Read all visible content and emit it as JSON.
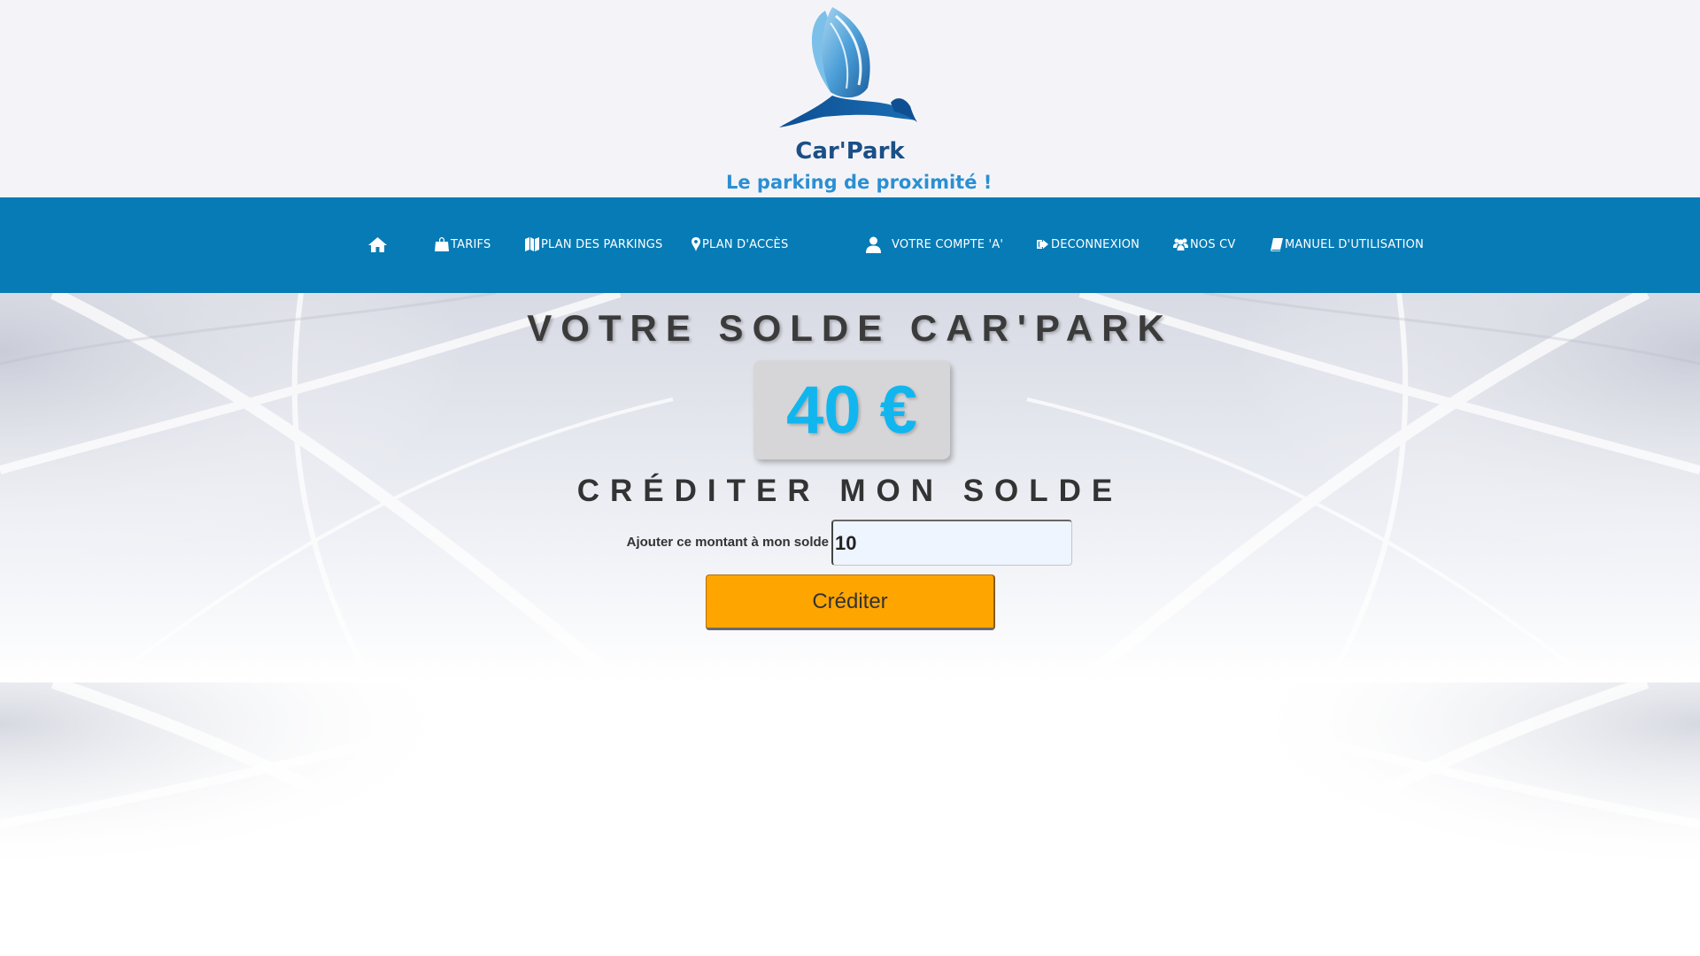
{
  "brand": {
    "name": "Car'Park",
    "tagline": "Le parking de proximité !"
  },
  "nav": {
    "items": [
      {
        "label": "",
        "icon": "home-icon"
      },
      {
        "label": "TARIFS",
        "icon": "shopping-bag-icon"
      },
      {
        "label": "PLAN DES PARKINGS",
        "icon": "map-icon"
      },
      {
        "label": "PLAN D'ACCÈS",
        "icon": "map-marker-icon"
      },
      {
        "label": "VOTRE COMPTE 'A'",
        "icon": "user-icon"
      },
      {
        "label": "DECONNEXION",
        "icon": "sign-out-icon"
      },
      {
        "label": "NOS CV",
        "icon": "users-icon"
      },
      {
        "label": "MANUEL D'UTILISATION",
        "icon": "book-icon"
      }
    ]
  },
  "balance": {
    "title": "VOTRE SOLDE CAR'PARK",
    "value": "40 €"
  },
  "credit": {
    "title": "CRÉDITER MON SOLDE",
    "label": "Ajouter ce montant à mon solde",
    "input_value": "10",
    "button_label": "Créditer"
  },
  "colors": {
    "nav_background": "#067bb6",
    "balance_text": "#11b6ef",
    "button_background": "#ffa500",
    "logo_dark_blue": "#1b4f86",
    "logo_light_blue": "#2b8fd3"
  }
}
